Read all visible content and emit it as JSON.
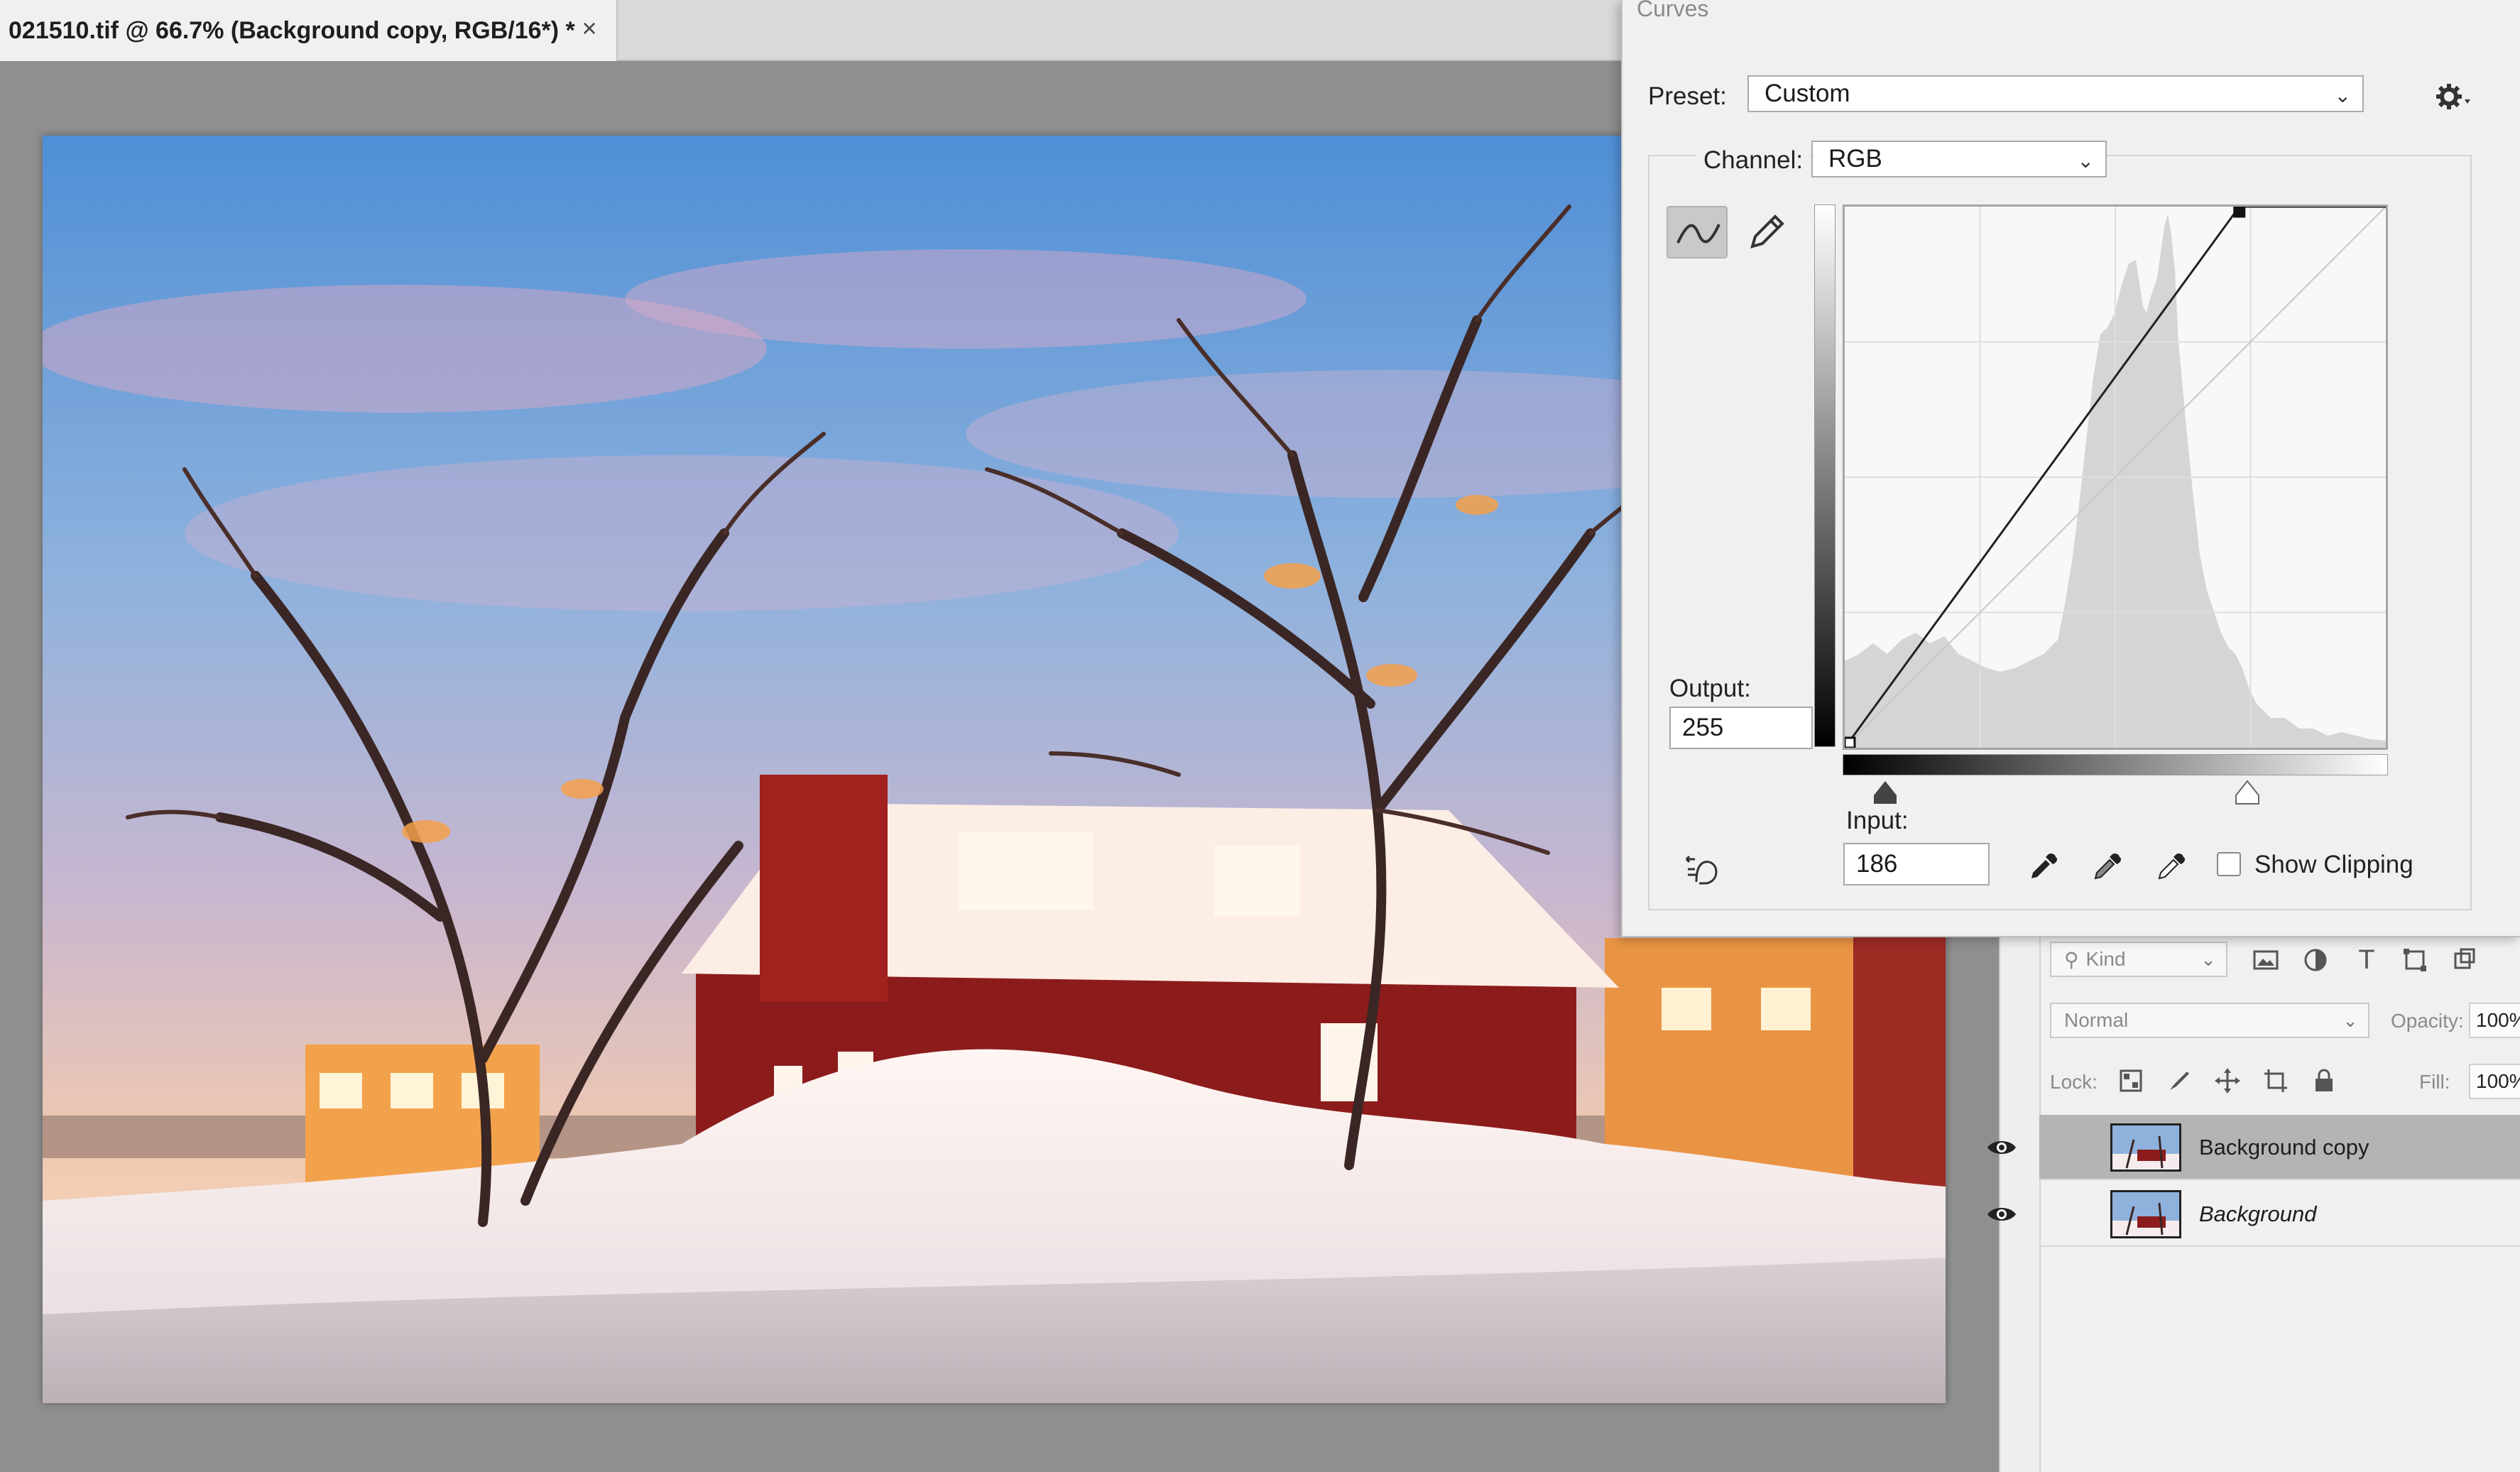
{
  "document": {
    "tab_title": "021510.tif @ 66.7% (Background copy, RGB/16*) *",
    "close_glyph": "×"
  },
  "curves": {
    "title": "Curves",
    "preset_label": "Preset:",
    "preset_value": "Custom",
    "channel_label": "Channel:",
    "channel_value": "RGB",
    "output_label": "Output:",
    "output_value": "255",
    "input_label": "Input:",
    "input_value": "186",
    "show_clipping_label": "Show Clipping",
    "show_clipping_checked": false,
    "point_mode_active": true,
    "curve_points": [
      [
        0,
        0
      ],
      [
        186,
        255
      ]
    ],
    "icons": {
      "settings": "gear-icon",
      "point_mode": "curve-points-icon",
      "pencil_mode": "pencil-icon",
      "auto": "hand-adjust-icon",
      "black_eyedropper": "eyedropper-black-icon",
      "gray_eyedropper": "eyedropper-gray-icon",
      "white_eyedropper": "eyedropper-white-icon"
    }
  },
  "layers": {
    "filter_kind_label": "Kind",
    "blend_mode": "Normal",
    "opacity_label": "Opacity:",
    "opacity_value": "100%",
    "lock_label": "Lock:",
    "fill_label": "Fill:",
    "fill_value": "100%",
    "items": [
      {
        "name": "Background copy",
        "visible": true,
        "selected": true
      },
      {
        "name": "Background",
        "visible": true,
        "selected": false
      }
    ]
  },
  "colors": {
    "panel_bg": "#f0f0f0",
    "selected_layer": "#b4b4b4",
    "canvas_bg": "#8f8f8f"
  }
}
